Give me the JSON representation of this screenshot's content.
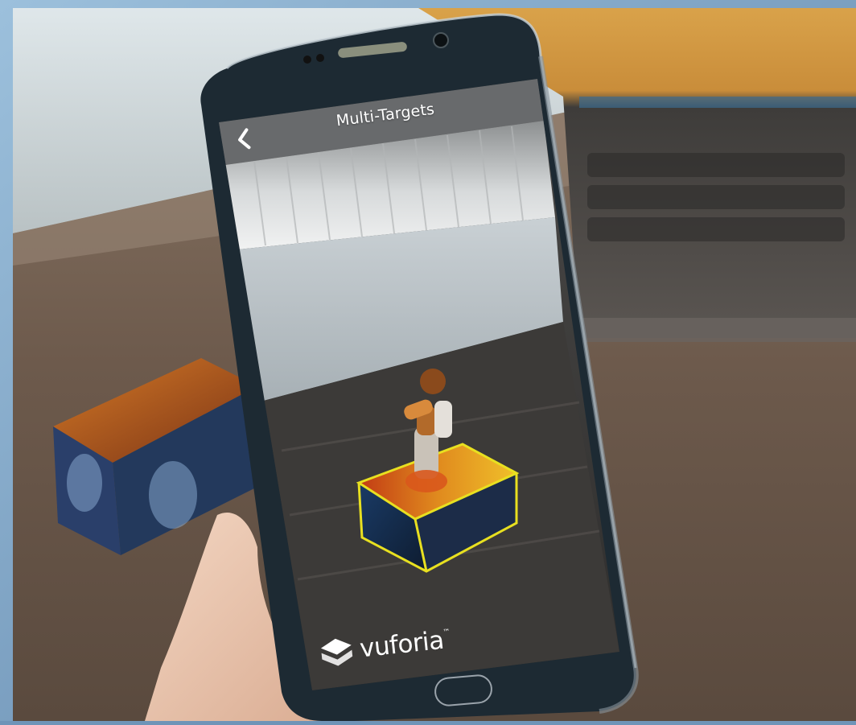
{
  "app": {
    "title": "Multi-Targets",
    "back_icon": "chevron-left-icon"
  },
  "watermark": {
    "brand": "vuforia",
    "trademark": "™",
    "icon": "vuforia-logo-icon"
  },
  "phone": {
    "home_button_icon": "home-button-icon"
  },
  "colors": {
    "frame_blue": "#6f94b8",
    "target_outline": "#e8e020",
    "phone_body": "#1d2a33"
  }
}
